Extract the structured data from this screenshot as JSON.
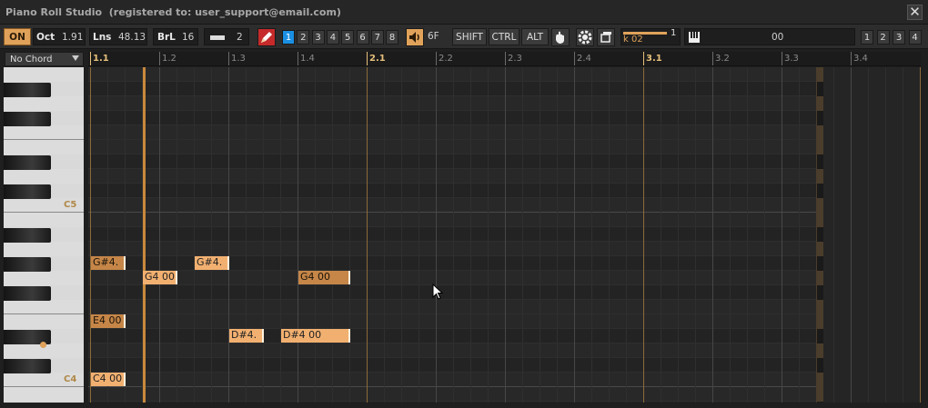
{
  "window": {
    "title": "Piano Roll Studio  (registered to: user_support@email.com)",
    "close_label": "✕"
  },
  "toolbar": {
    "on_label": "ON",
    "oct_label": "Oct",
    "oct_value": "1.91",
    "lns_label": "Lns",
    "lns_value": "48.13",
    "brl_label": "BrL",
    "brl_value": "16",
    "snap_value": "2",
    "layer_buttons": [
      "1",
      "2",
      "3",
      "4",
      "5",
      "6",
      "7",
      "8"
    ],
    "selected_layer": "1",
    "volume_value": "6F",
    "shift_label": "SHIFT",
    "ctrl_label": "CTRL",
    "alt_label": "ALT",
    "velocity_label": "k 02",
    "velocity_count": "1",
    "midi_value": "00",
    "channel_buttons": [
      "1",
      "2",
      "3",
      "4"
    ],
    "accent_color": "#e0a25a",
    "pencil_color": "#c62a2a",
    "layer_color": "#1a8fe3"
  },
  "chord_selector": {
    "value": "No Chord"
  },
  "ruler": {
    "labels": [
      "1.1",
      "1.2",
      "1.3",
      "1.4",
      "2.1",
      "2.2",
      "2.3",
      "2.4",
      "3.1",
      "3.2",
      "3.3",
      "3.4"
    ],
    "bar_labels": [
      "1.1",
      "2.1",
      "3.1"
    ]
  },
  "keyboard": {
    "octave_labels": [
      "C5",
      "C4"
    ]
  },
  "notes": [
    {
      "label": "G#4.",
      "style": "dim"
    },
    {
      "label": "G#4.",
      "style": "sel"
    },
    {
      "label": "G4 00",
      "style": "sel"
    },
    {
      "label": "G4 00",
      "style": "dim"
    },
    {
      "label": "E4 00",
      "style": "dim"
    },
    {
      "label": "D#4.",
      "style": "sel"
    },
    {
      "label": "D#4 00",
      "style": "sel"
    },
    {
      "label": "C4 00",
      "style": "sel"
    }
  ]
}
